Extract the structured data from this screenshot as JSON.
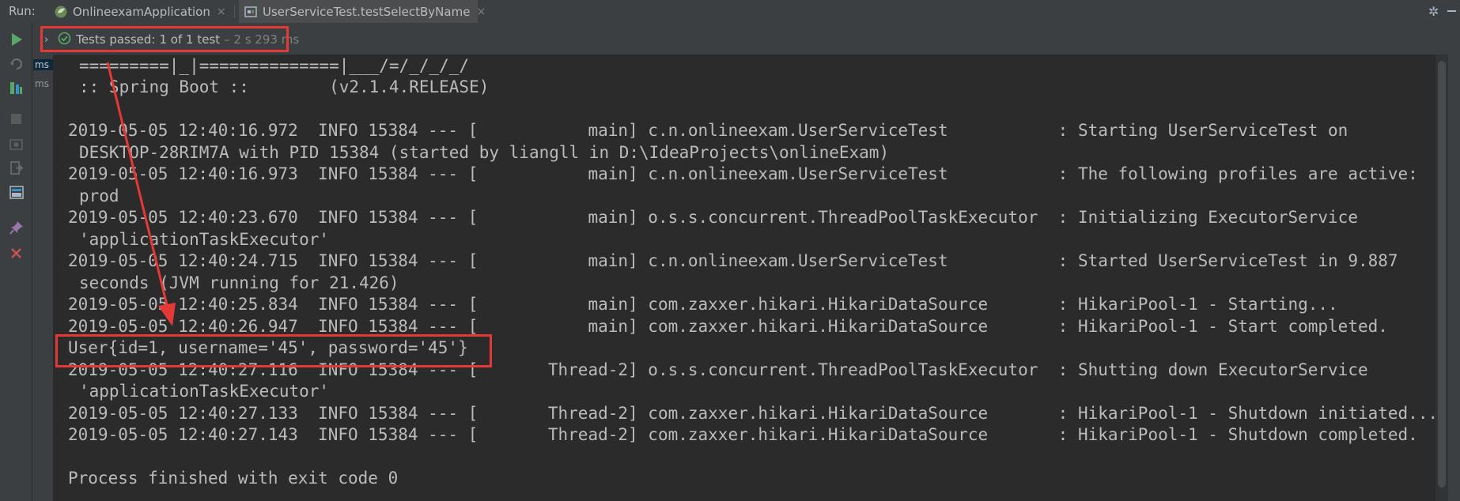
{
  "tabbar": {
    "run_label": "Run:",
    "tabs": [
      {
        "label": "OnlineexamApplication",
        "icon": "spring-boot-icon"
      },
      {
        "label": "UserServiceTest.testSelectByName",
        "icon": "test-config-icon"
      }
    ],
    "close_glyph": "×",
    "gear_glyph": "✲"
  },
  "status": {
    "chevron": "›",
    "passed_text": "Tests passed:",
    "count_text": "1 of 1 test",
    "timing_text": "– 2 s 293 ms",
    "accent_color": "#e53935"
  },
  "left_toolbar": {
    "icons": [
      "rerun-icon",
      "rerun-failed-icon",
      "toggle-tests-icon",
      "stop-icon",
      "snapshot-icon",
      "exit-icon",
      "layout-icon",
      "pin-icon",
      "close-icon"
    ]
  },
  "ms_column": [
    "ms",
    "ms"
  ],
  "console": {
    "lines": [
      "=========|_|==============|___/=/_/_/_/",
      ":: Spring Boot ::        (v2.1.4.RELEASE)",
      "",
      "2019-05-05 12:40:16.972  INFO 15384 --- [           main] c.n.onlineexam.UserServiceTest           : Starting UserServiceTest on",
      "DESKTOP-28RIM7A with PID 15384 (started by liangll in D:\\IdeaProjects\\onlineExam)",
      "2019-05-05 12:40:16.973  INFO 15384 --- [           main] c.n.onlineexam.UserServiceTest           : The following profiles are active:",
      "prod",
      "2019-05-05 12:40:23.670  INFO 15384 --- [           main] o.s.s.concurrent.ThreadPoolTaskExecutor  : Initializing ExecutorService",
      "'applicationTaskExecutor'",
      "2019-05-05 12:40:24.715  INFO 15384 --- [           main] c.n.onlineexam.UserServiceTest           : Started UserServiceTest in 9.887",
      "seconds (JVM running for 21.426)",
      "2019-05-05 12:40:25.834  INFO 15384 --- [           main] com.zaxxer.hikari.HikariDataSource       : HikariPool-1 - Starting...",
      "2019-05-05 12:40:26.947  INFO 15384 --- [           main] com.zaxxer.hikari.HikariDataSource       : HikariPool-1 - Start completed.",
      "User{id=1, username='45', password='45'}",
      "2019-05-05 12:40:27.116  INFO 15384 --- [       Thread-2] o.s.s.concurrent.ThreadPoolTaskExecutor  : Shutting down ExecutorService",
      "'applicationTaskExecutor'",
      "2019-05-05 12:40:27.133  INFO 15384 --- [       Thread-2] com.zaxxer.hikari.HikariDataSource       : HikariPool-1 - Shutdown initiated...",
      "2019-05-05 12:40:27.143  INFO 15384 --- [       Thread-2] com.zaxxer.hikari.HikariDataSource       : HikariPool-1 - Shutdown completed.",
      "",
      "Process finished with exit code 0"
    ]
  }
}
